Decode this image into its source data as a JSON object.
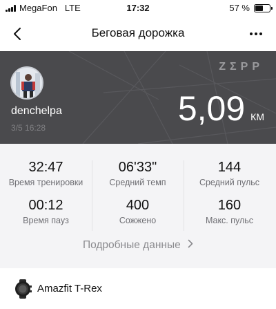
{
  "status_bar": {
    "carrier": "MegaFon",
    "network": "LTE",
    "time": "17:32",
    "battery_text": "57 %",
    "battery_level": 0.57
  },
  "nav": {
    "title": "Беговая дорожка"
  },
  "workout": {
    "brand": "ZΣPP",
    "username": "denchelpa",
    "datetime": "3/5 16:28",
    "distance": "5,09",
    "distance_unit": "КМ"
  },
  "stats": [
    {
      "value": "32:47",
      "label": "Время тренировки"
    },
    {
      "value": "06'33\"",
      "label": "Средний темп"
    },
    {
      "value": "144",
      "label": "Средний пульс"
    },
    {
      "value": "00:12",
      "label": "Время пауз"
    },
    {
      "value": "400",
      "label": "Сожжено"
    },
    {
      "value": "160",
      "label": "Макс. пульс"
    }
  ],
  "details_link": "Подробные данные",
  "device": {
    "name": "Amazfit T-Rex",
    "icon": "watch-icon"
  },
  "colors": {
    "hero_bg": "#4a4a4d",
    "stats_bg": "#f4f4f6"
  }
}
